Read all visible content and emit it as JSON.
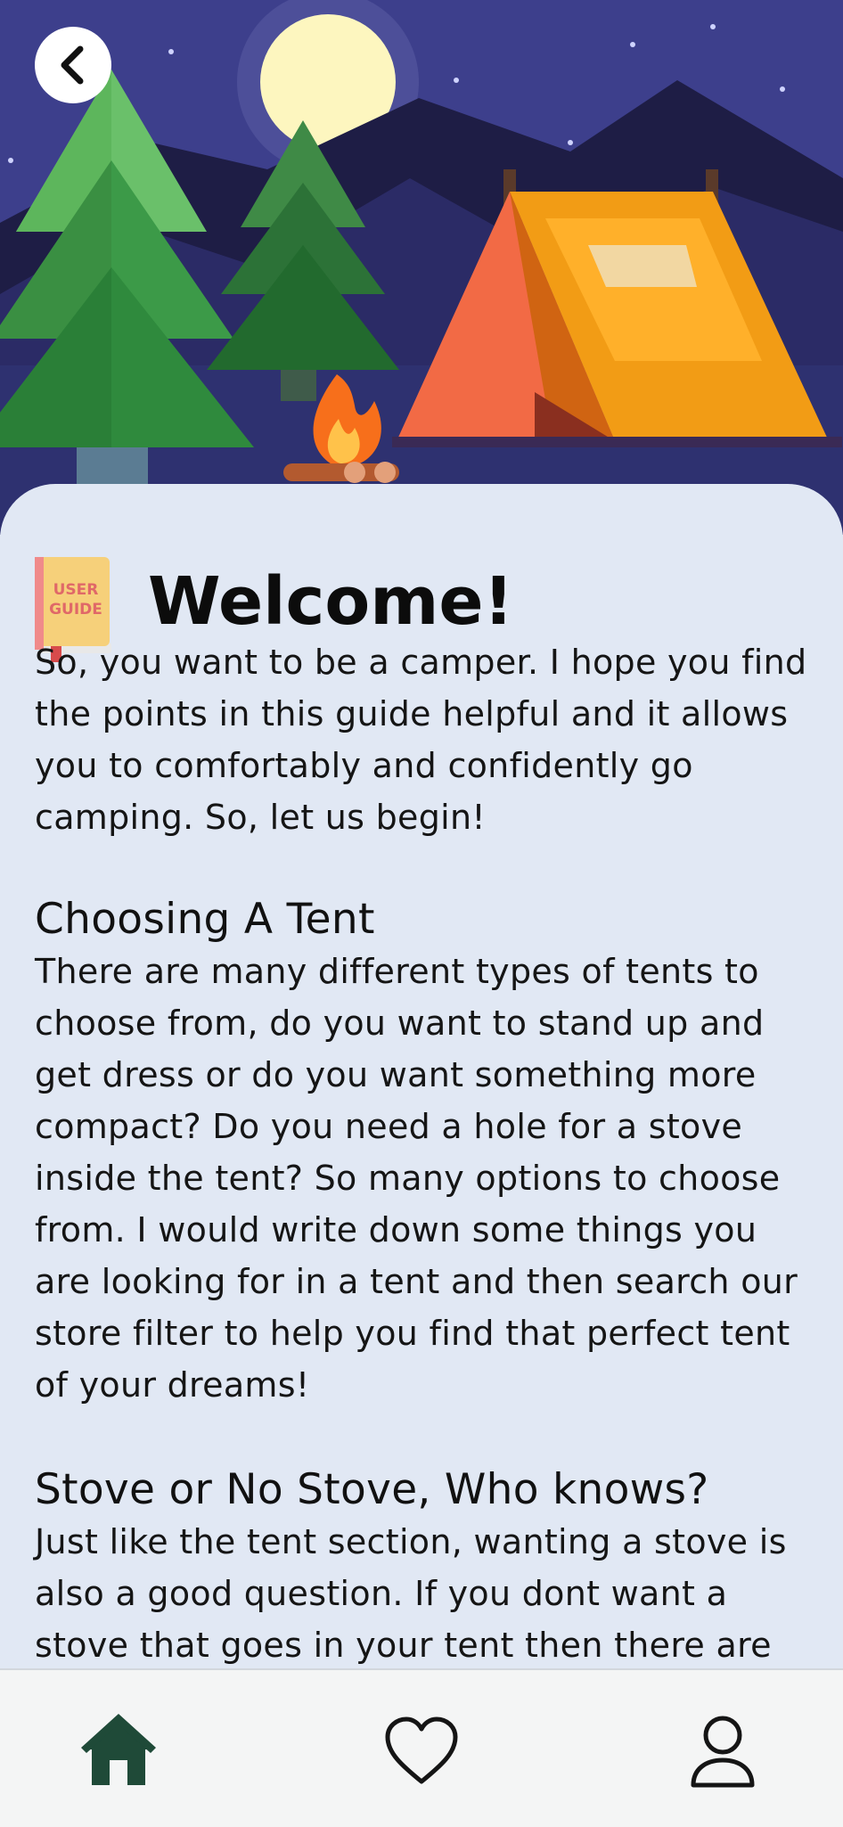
{
  "hero": {
    "illustration": "camping-night-scene"
  },
  "header": {
    "back_icon": "chevron-left-icon"
  },
  "welcome": {
    "book_label": "USER GUIDE",
    "title": "Welcome!",
    "intro": "So, you want to be a camper. I hope you find the points in this guide helpful and it allows you to comfortably and confidently go camping.  So, let us begin!"
  },
  "sections": [
    {
      "heading": "Choosing A Tent",
      "body": "There are many different types of tents to choose from, do you want to stand up and get dress or do you want something more compact? Do you need a hole for a stove inside the tent? So many options to choose from. I would write down some things you are looking for in a tent and then search our store filter to help you find that perfect tent of your dreams!"
    },
    {
      "heading": "Stove or No Stove, Who knows?",
      "body": "Just like the tent section, wanting a stove is also a good question. If you dont want a stove that goes in your tent then there are"
    }
  ],
  "nav": {
    "items": [
      {
        "icon": "home-icon",
        "active": true
      },
      {
        "icon": "heart-icon",
        "active": false
      },
      {
        "icon": "user-icon",
        "active": false
      }
    ],
    "active_color": "#1f4a38"
  }
}
